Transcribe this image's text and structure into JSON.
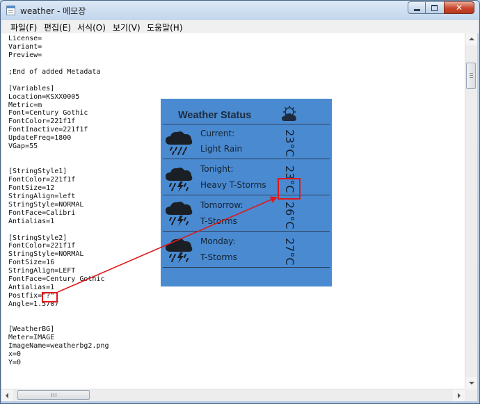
{
  "window": {
    "title": "weather - 메모장"
  },
  "menu": [
    "파일(F)",
    "편집(E)",
    "서식(O)",
    "보기(V)",
    "도움말(H)"
  ],
  "editor": {
    "lines": [
      "License=",
      "Variant=",
      "Preview=",
      "",
      ";End of added Metadata",
      "",
      "[Variables]",
      "Location=KSXX0005",
      "Metric=m",
      "Font=Century Gothic",
      "FontColor=221f1f",
      "FontInactive=221f1f",
      "UpdateFreq=1800",
      "VGap=55",
      "",
      "",
      "[StringStyle1]",
      "FontColor=221f1f",
      "FontSize=12",
      "StringAlign=left",
      "StringStyle=NORMAL",
      "FontFace=Calibri",
      "Antialias=1",
      "",
      "[StringStyle2]",
      "FontColor=221f1f",
      "StringStyle=NORMAL",
      "FontSize=16",
      "StringAlign=LEFT",
      "FontFace=Century Gothic",
      "Antialias=1",
      "Postfix=\"?\"",
      "Angle=1.5707",
      "",
      "",
      "[WeatherBG]",
      "Meter=IMAGE",
      "ImageName=weatherbg2.png",
      "x=0",
      "Y=0"
    ]
  },
  "weather_widget": {
    "title": "Weather Status",
    "entries": [
      {
        "label": "Current:",
        "condition": "Light Rain",
        "temp": "23°C",
        "icon": "rain-cloud-icon"
      },
      {
        "label": "Tonight:",
        "condition": "Heavy T-Storms",
        "temp": "23°C",
        "icon": "thunderstorm-cloud-icon"
      },
      {
        "label": "Tomorrow:",
        "condition": "T-Storms",
        "temp": "26°C",
        "icon": "thunderstorm-cloud-icon"
      },
      {
        "label": "Monday:",
        "condition": "T-Storms",
        "temp": "27°C",
        "icon": "thunderstorm-cloud-icon"
      }
    ]
  },
  "colors": {
    "widget_bg": "#4a8ad0",
    "annotation": "#e01818",
    "text_dark": "#142233"
  }
}
